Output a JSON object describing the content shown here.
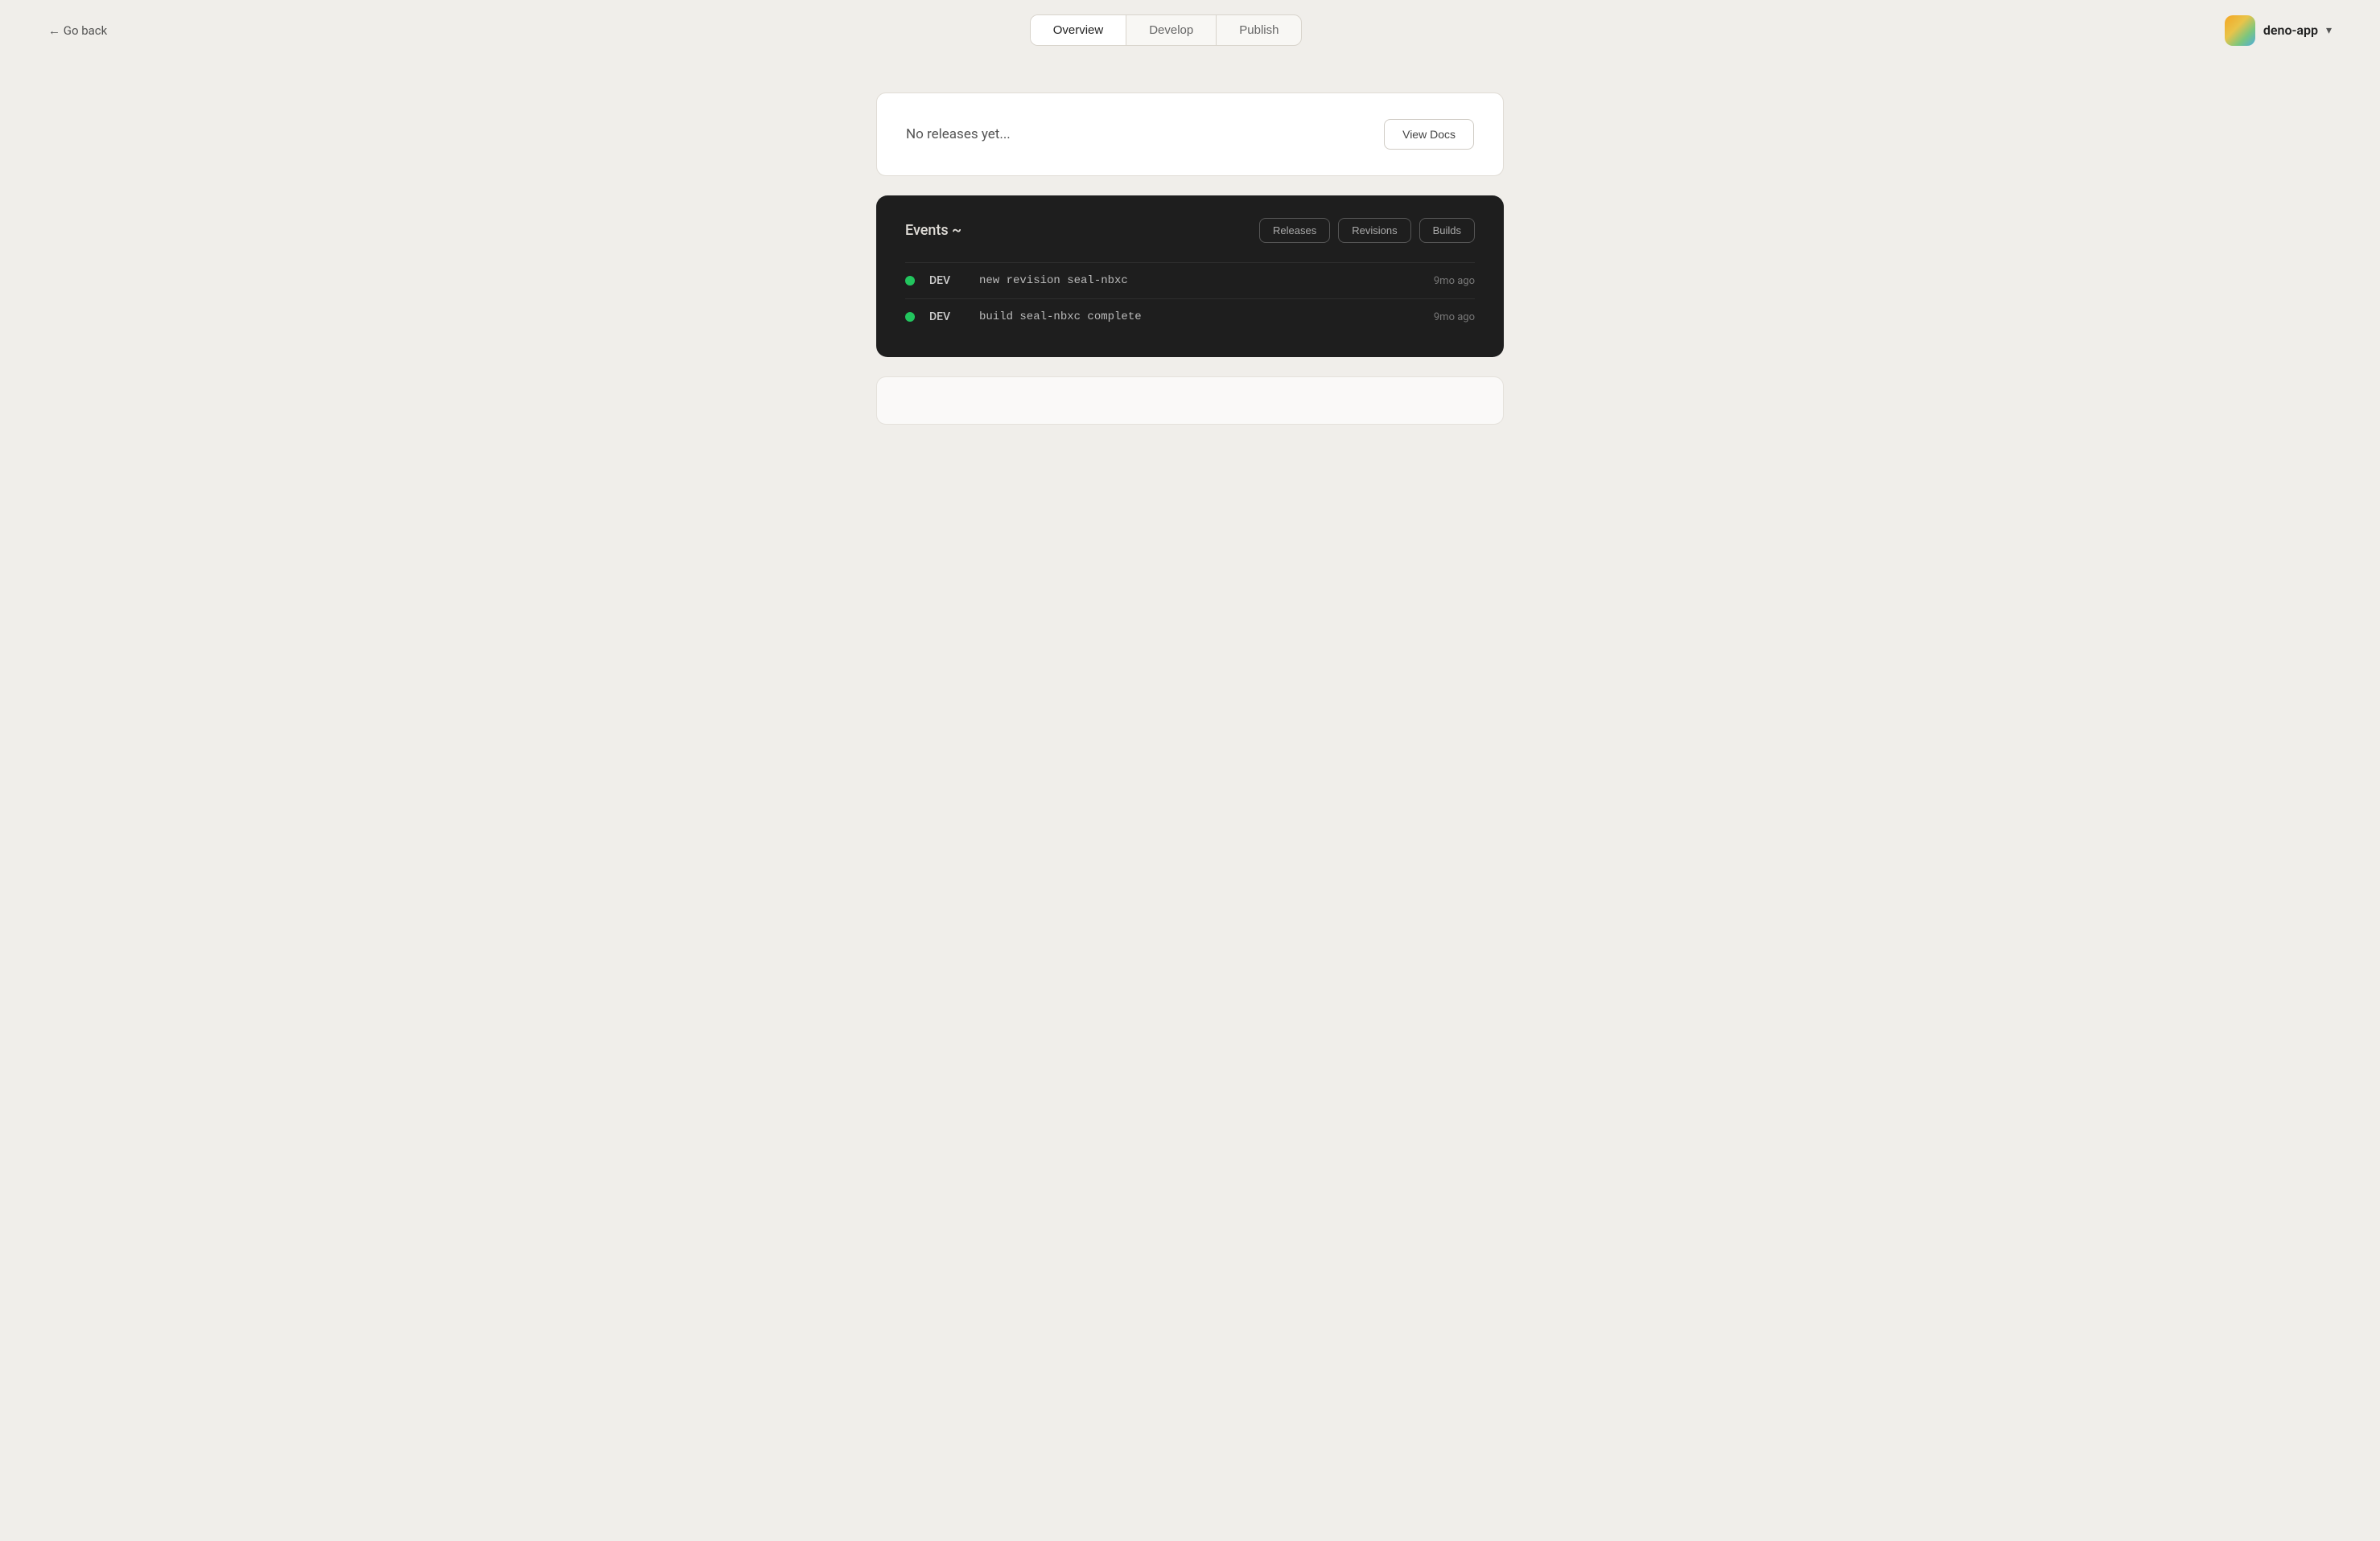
{
  "header": {
    "go_back_label": "← Go back",
    "nav_tabs": [
      {
        "id": "overview",
        "label": "Overview",
        "active": true
      },
      {
        "id": "develop",
        "label": "Develop",
        "active": false
      },
      {
        "id": "publish",
        "label": "Publish",
        "active": false
      }
    ],
    "app_name": "deno-app"
  },
  "no_releases": {
    "text": "No releases yet...",
    "view_docs_label": "View Docs"
  },
  "events": {
    "title": "Events ~",
    "filter_buttons": [
      {
        "id": "releases",
        "label": "Releases"
      },
      {
        "id": "revisions",
        "label": "Revisions"
      },
      {
        "id": "builds",
        "label": "Builds"
      }
    ],
    "rows": [
      {
        "status": "success",
        "env": "DEV",
        "message": "new revision seal-nbxc",
        "time": "9mo ago"
      },
      {
        "status": "success",
        "env": "DEV",
        "message": "build seal-nbxc complete",
        "time": "9mo ago"
      }
    ]
  }
}
